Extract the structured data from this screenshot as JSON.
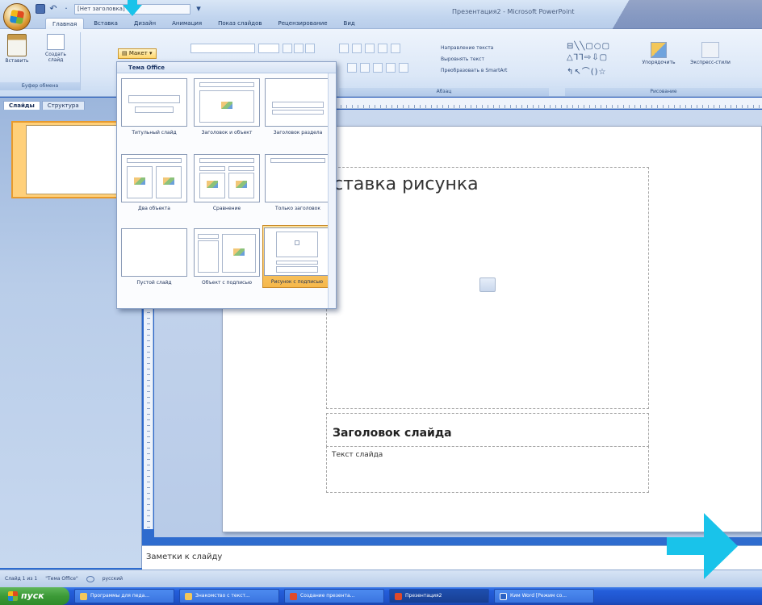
{
  "window": {
    "title": "Презентация2 - Microsoft PowerPoint",
    "quick_access_field": "[Нет заголовка]"
  },
  "ribbon_tabs": [
    {
      "label": "Главная",
      "active": true
    },
    {
      "label": "Вставка"
    },
    {
      "label": "Дизайн"
    },
    {
      "label": "Анимация"
    },
    {
      "label": "Показ слайдов"
    },
    {
      "label": "Рецензирование"
    },
    {
      "label": "Вид"
    }
  ],
  "ribbon": {
    "paste_label": "Вставить",
    "new_slide_label": "Создать слайд",
    "layout_button": "Макет",
    "clipboard_group": "Буфер обмена",
    "paragraph_group": "Абзац",
    "drawing_group": "Рисование",
    "text_direction": "Направление текста",
    "align_text": "Выровнять текст",
    "convert_smartart": "Преобразовать в SmartArt",
    "arrange_label": "Упорядочить",
    "quick_styles_label": "Экспресс-стили"
  },
  "left_panel": {
    "tabs": [
      {
        "label": "Слайды",
        "active": true
      },
      {
        "label": "Структура"
      }
    ]
  },
  "layout_gallery": {
    "header": "Тема Office",
    "items": [
      {
        "label": "Титульный слайд"
      },
      {
        "label": "Заголовок и объект"
      },
      {
        "label": "Заголовок раздела"
      },
      {
        "label": "Два объекта"
      },
      {
        "label": "Сравнение"
      },
      {
        "label": "Только заголовок"
      },
      {
        "label": "Пустой слайд"
      },
      {
        "label": "Объект с подписью"
      },
      {
        "label": "Рисунок с подписью",
        "selected": true
      }
    ]
  },
  "slide": {
    "picture_placeholder": "ставка рисунка",
    "title_placeholder": "Заголовок слайда",
    "text_placeholder": "Текст слайда"
  },
  "notes": {
    "placeholder": "Заметки к слайду"
  },
  "status_bar": {
    "slide_counter": "Слайд 1 из 1",
    "theme": "\"Тема Office\"",
    "language": "русский"
  },
  "taskbar": {
    "start_label": "пуск",
    "tasks": [
      {
        "label": "Программы для педа..."
      },
      {
        "label": "Знакомство с текст..."
      },
      {
        "label": "Создание презента..."
      },
      {
        "label": "Презентация2",
        "active": true
      },
      {
        "label": "Ким Word [Режим со..."
      }
    ]
  },
  "colors": {
    "accent_cyan": "#19c3ea",
    "selection_orange": "#f6b84b",
    "ribbon_blue": "#dbe7f7"
  }
}
